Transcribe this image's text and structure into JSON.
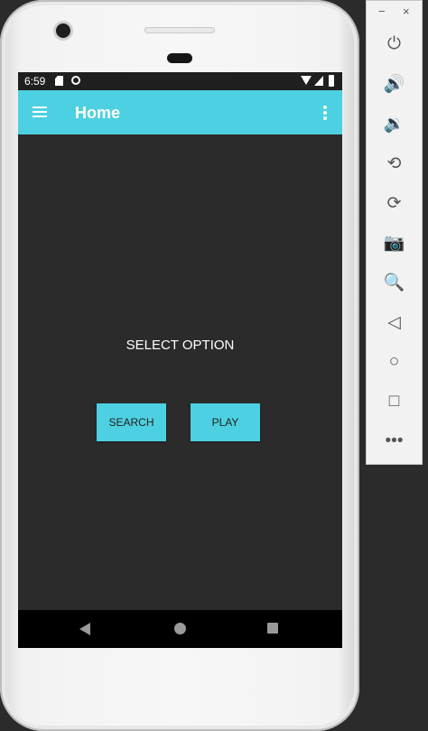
{
  "phone": {
    "status_bar": {
      "time": "6:59"
    },
    "app_bar": {
      "title": "Home"
    },
    "main": {
      "prompt": "SELECT OPTION",
      "buttons": {
        "search": "SEARCH",
        "play": "PLAY"
      }
    }
  },
  "toolbar": {
    "minimize_label": "−",
    "close_label": "×",
    "items": [
      {
        "name": "power",
        "glyph": "⏻"
      },
      {
        "name": "volume-up",
        "glyph": "🔊"
      },
      {
        "name": "volume-down",
        "glyph": "🔉"
      },
      {
        "name": "rotate-left",
        "glyph": "⟲"
      },
      {
        "name": "rotate-right",
        "glyph": "⟳"
      },
      {
        "name": "screenshot",
        "glyph": "📷"
      },
      {
        "name": "zoom",
        "glyph": "🔍"
      },
      {
        "name": "back",
        "glyph": "◁"
      },
      {
        "name": "home",
        "glyph": "○"
      },
      {
        "name": "overview",
        "glyph": "□"
      },
      {
        "name": "more",
        "glyph": "•••"
      }
    ]
  },
  "colors": {
    "accent": "#4dd0e1",
    "background": "#2b2b2b",
    "nav_bar": "#000000"
  }
}
